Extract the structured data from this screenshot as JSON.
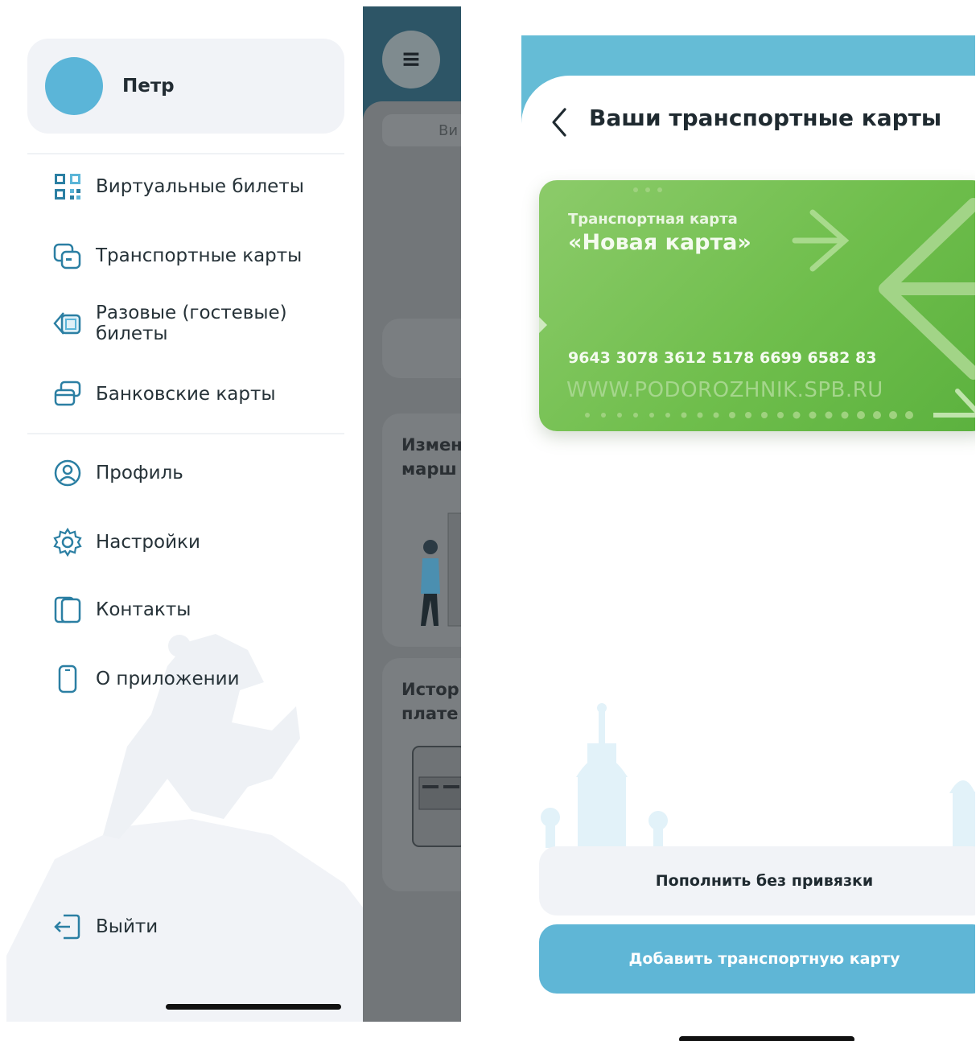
{
  "drawer": {
    "user_name": "Петр",
    "menu": [
      {
        "label": "Виртуальные билеты",
        "icon": "qr-code-icon"
      },
      {
        "label": "Транспортные карты",
        "icon": "transport-card-icon"
      },
      {
        "label": "Разовые (гостевые) билеты",
        "icon": "guest-ticket-icon"
      },
      {
        "label": "Банковские карты",
        "icon": "bank-card-icon"
      },
      {
        "label": "Профиль",
        "icon": "profile-icon"
      },
      {
        "label": "Настройки",
        "icon": "gear-icon"
      },
      {
        "label": "Контакты",
        "icon": "contacts-icon"
      },
      {
        "label": "О приложении",
        "icon": "phone-icon"
      }
    ],
    "logout_label": "Выйти"
  },
  "background_app": {
    "pill_text": "Ви",
    "block1_title": "Измен\nмарш",
    "block2_title": "Истор\nплате"
  },
  "cards_screen": {
    "title": "Ваши транспортные карты",
    "card": {
      "subtitle": "Транспортная карта",
      "name": "«Новая карта»",
      "number": "9643 3078 3612 5178 6699 6582 83",
      "website": "WWW.PODOROZHNIK.SPB.RU"
    },
    "secondary_button": "Пополнить без привязки",
    "primary_button": "Добавить транспортную карту"
  },
  "colors": {
    "accent_blue": "#5fb6d6",
    "avatar": "#5bb5d8",
    "card_green": "#6fbe4c"
  }
}
